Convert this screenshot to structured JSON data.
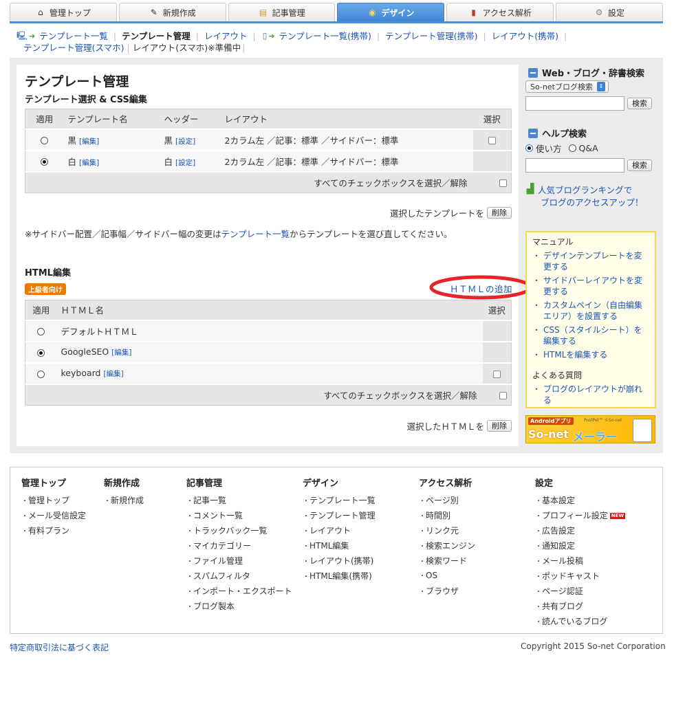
{
  "topnav": [
    {
      "label": "管理トップ",
      "icon": "home-icon",
      "active": false
    },
    {
      "label": "新規作成",
      "icon": "pencil-icon",
      "active": false
    },
    {
      "label": "記事管理",
      "icon": "folder-icon",
      "active": false
    },
    {
      "label": "デザイン",
      "icon": "palette-icon",
      "active": true
    },
    {
      "label": "アクセス解析",
      "icon": "bar-chart-icon",
      "active": false
    },
    {
      "label": "設定",
      "icon": "gear-icon",
      "active": false
    }
  ],
  "subnav": {
    "pc_items": [
      "テンプレート一覧",
      "テンプレート管理",
      "レイアウト"
    ],
    "mobile_items": [
      "テンプレート一覧(携帯)",
      "テンプレート管理(携帯)",
      "レイアウト(携帯)"
    ],
    "smartphone_items": [
      "テンプレート管理(スマホ)",
      "レイアウト(スマホ)※準備中"
    ],
    "current": "テンプレート管理"
  },
  "page": {
    "title": "テンプレート管理",
    "template_section": "テンプレート選択 & CSS編集",
    "template_table": {
      "headers": [
        "適用",
        "テンプレート名",
        "ヘッダー",
        "レイアウト",
        "選択"
      ],
      "rows": [
        {
          "selected": false,
          "name": "黒",
          "edit": "[編集]",
          "header": "黒",
          "header_link": "[設定]",
          "layout": "2カラム左 ／記事：標準 ／サイドバー：標準",
          "checkbox": true
        },
        {
          "selected": true,
          "name": "白",
          "edit": "[編集]",
          "header": "白",
          "header_link": "[設定]",
          "layout": "2カラム左 ／記事：標準 ／サイドバー：標準",
          "checkbox": false
        }
      ],
      "select_all": "すべてのチェックボックスを選択／解除"
    },
    "delete_template_label": "選択したテンプレートを",
    "delete_button": "削除",
    "note_prefix": "※サイドバー配置／記事幅／サイドバー幅の変更は",
    "note_link": "テンプレート一覧",
    "note_suffix": "からテンプレートを選び直してください。",
    "html_section": "HTML編集",
    "badge": "上級者向け",
    "add_html": "ＨＴＭＬの追加",
    "html_table": {
      "headers": [
        "適用",
        "ＨＴＭＬ名",
        "選択"
      ],
      "rows": [
        {
          "selected": false,
          "name": "デフォルトＨＴＭＬ",
          "edit": "",
          "checkbox": false
        },
        {
          "selected": true,
          "name": "GoogleSEO",
          "edit": "[編集]",
          "checkbox": false
        },
        {
          "selected": false,
          "name": "keyboard",
          "edit": "[編集]",
          "checkbox": true
        }
      ],
      "select_all": "すべてのチェックボックスを選択／解除"
    },
    "delete_html_label": "選択したＨＴＭＬを"
  },
  "sidebar": {
    "web_search_title": "Web・ブログ・辞書検索",
    "search_select": "So-netブログ検索",
    "search_button": "検索",
    "help_title": "ヘルプ検索",
    "help_options": [
      "使い方",
      "Q&A"
    ],
    "help_selected": "使い方",
    "ranking_link_1": "人気ブログランキングで",
    "ranking_link_2": "ブログのアクセスアップ！",
    "manual_title": "マニュアル",
    "manual_items": [
      "デザインテンプレートを変更する",
      "サイドバーレイアウトを変更する",
      "カスタムペイン（自由編集エリア）を設置する",
      "CSS（スタイルシート）を編集する",
      "HTMLを編集する"
    ],
    "faq_title": "よくある質問",
    "faq_items": [
      "ブログのレイアウトが崩れる"
    ],
    "banner": {
      "app": "Androidアプリ",
      "pp": "PostPet™ ©So-net",
      "brand": "So-net",
      "name": "メーラー"
    }
  },
  "footer": {
    "columns": [
      {
        "title": "管理トップ",
        "items": [
          "管理トップ",
          "メール受信設定",
          "有料プラン"
        ]
      },
      {
        "title": "新規作成",
        "items": [
          "新規作成"
        ]
      },
      {
        "title": "記事管理",
        "items": [
          "記事一覧",
          "コメント一覧",
          "トラックバック一覧",
          "マイカテゴリー",
          "ファイル管理",
          "スパムフィルタ",
          "インポート・エクスポート",
          "ブログ製本"
        ]
      },
      {
        "title": "デザイン",
        "items": [
          "テンプレート一覧",
          "テンプレート管理",
          "レイアウト",
          "HTML編集",
          "レイアウト(携帯)",
          "HTML編集(携帯)"
        ]
      },
      {
        "title": "アクセス解析",
        "items": [
          "ページ別",
          "時間別",
          "リンク元",
          "検索エンジン",
          "検索ワード",
          "OS",
          "ブラウザ"
        ]
      },
      {
        "title": "設定",
        "items": [
          "基本設定",
          "プロフィール設定",
          "広告設定",
          "通知設定",
          "メール投稿",
          "ポッドキャスト",
          "ページ認証",
          "共有ブログ",
          "読んでいるブログ"
        ]
      }
    ],
    "new_badge": "NEW",
    "legal_link": "特定商取引法に基づく表記",
    "copyright": "Copyright 2015 So-net Corporation"
  },
  "colors": {
    "accent": "#4a8fd6",
    "link": "#1a55b3",
    "highlight": "#e8232a",
    "badge": "#ea7a00"
  }
}
